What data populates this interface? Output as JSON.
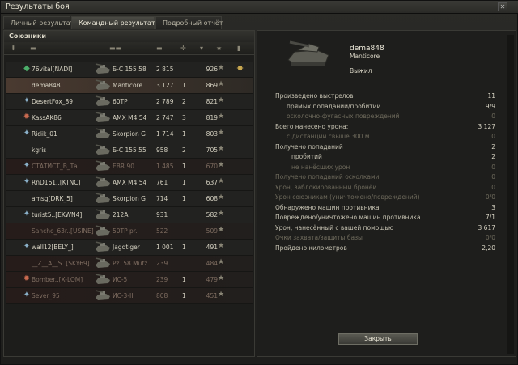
{
  "window": {
    "title": "Результаты боя"
  },
  "tabs": [
    {
      "label": "Личный результат",
      "active": false
    },
    {
      "label": "Командный результат",
      "active": true
    },
    {
      "label": "Подробный отчёт",
      "active": false
    }
  ],
  "team": {
    "header": "Союзники",
    "players": [
      {
        "name": "76vital[NADI]",
        "tank": "Б-С 155 58",
        "damage": "2 815",
        "kills": "",
        "xp": "926",
        "clan_icon": "clan-badge-green-icon",
        "dead": false,
        "highlight": false,
        "medal": true
      },
      {
        "name": "dema848",
        "tank": "Manticore",
        "damage": "3 127",
        "kills": "1",
        "xp": "869",
        "clan_icon": "",
        "dead": false,
        "highlight": true,
        "medal": false
      },
      {
        "name": "DesertFox_89",
        "tank": "60TP",
        "damage": "2 789",
        "kills": "2",
        "xp": "821",
        "clan_icon": "clan-badge-star-icon",
        "dead": false,
        "highlight": false,
        "medal": false
      },
      {
        "name": "KassAK86",
        "tank": "AMX M4 54",
        "damage": "2 747",
        "kills": "3",
        "xp": "819",
        "clan_icon": "clan-badge-red-icon",
        "dead": false,
        "highlight": false,
        "medal": false
      },
      {
        "name": "Ridik_01",
        "tank": "Skorpion G",
        "damage": "1 714",
        "kills": "1",
        "xp": "803",
        "clan_icon": "clan-badge-star-icon",
        "dead": false,
        "highlight": false,
        "medal": false
      },
      {
        "name": "kgris",
        "tank": "Б-С 155 55",
        "damage": "958",
        "kills": "2",
        "xp": "705",
        "clan_icon": "",
        "dead": false,
        "highlight": false,
        "medal": false
      },
      {
        "name": "СТАТИСТ_В_Та...",
        "tank": "EBR 90",
        "damage": "1 485",
        "kills": "1",
        "xp": "670",
        "clan_icon": "clan-badge-star-icon",
        "dead": true,
        "highlight": false,
        "medal": false
      },
      {
        "name": "RnD161..[KTNC]",
        "tank": "AMX M4 54",
        "damage": "761",
        "kills": "1",
        "xp": "637",
        "clan_icon": "clan-badge-star-icon",
        "dead": false,
        "highlight": false,
        "medal": false
      },
      {
        "name": "amsg[DRK_5]",
        "tank": "Skorpion G",
        "damage": "714",
        "kills": "1",
        "xp": "608",
        "clan_icon": "",
        "dead": false,
        "highlight": false,
        "medal": false
      },
      {
        "name": "turist5..[EKWN4]",
        "tank": "212A",
        "damage": "931",
        "kills": "",
        "xp": "582",
        "clan_icon": "clan-badge-star-icon",
        "dead": false,
        "highlight": false,
        "medal": false
      },
      {
        "name": "Sancho_63r..[USINE]",
        "tank": "50TP pr.",
        "damage": "522",
        "kills": "",
        "xp": "509",
        "clan_icon": "",
        "dead": true,
        "highlight": false,
        "medal": false
      },
      {
        "name": "wall12[BELY_]",
        "tank": "Jagdtiger",
        "damage": "1 001",
        "kills": "1",
        "xp": "491",
        "clan_icon": "clan-badge-star-icon",
        "dead": false,
        "highlight": false,
        "medal": false
      },
      {
        "name": "__Z__A__S..[SKY69]",
        "tank": "Pz. 58 Mutz",
        "damage": "239",
        "kills": "",
        "xp": "484",
        "clan_icon": "",
        "dead": true,
        "highlight": false,
        "medal": false
      },
      {
        "name": "Bomber..[X-LOM]",
        "tank": "ИС-5",
        "damage": "239",
        "kills": "1",
        "xp": "479",
        "clan_icon": "clan-badge-red-icon",
        "dead": true,
        "highlight": false,
        "medal": false
      },
      {
        "name": "Sever_95",
        "tank": "ИС-3-II",
        "damage": "808",
        "kills": "1",
        "xp": "451",
        "clan_icon": "clan-badge-star-icon",
        "dead": true,
        "highlight": false,
        "medal": false
      }
    ]
  },
  "player_detail": {
    "name": "dema848",
    "tank": "Manticore",
    "status": "Выжил",
    "stats": [
      {
        "label": "Произведено выстрелов",
        "value": "11",
        "level": 0,
        "muted": false
      },
      {
        "label": "прямых попаданий/пробитий",
        "value": "9/9",
        "level": 1,
        "muted": false
      },
      {
        "label": "осколочно-фугасных повреждений",
        "value": "0",
        "level": 1,
        "muted": true
      },
      {
        "label": "Всего нанесено урона:",
        "value": "3 127",
        "level": 0,
        "muted": false
      },
      {
        "label": "с дистанции свыше 300 м",
        "value": "0",
        "level": 1,
        "muted": true
      },
      {
        "label": "Получено попаданий",
        "value": "2",
        "level": 0,
        "muted": false
      },
      {
        "label": "пробитий",
        "value": "2",
        "level": 2,
        "muted": false
      },
      {
        "label": "не нанёсших урон",
        "value": "0",
        "level": 2,
        "muted": true
      },
      {
        "label": "Получено попаданий осколками",
        "value": "0",
        "level": 0,
        "muted": true
      },
      {
        "label": "Урон, заблокированный бронёй",
        "value": "0",
        "level": 0,
        "muted": true
      },
      {
        "label": "Урон союзникам (уничтожено/повреждений)",
        "value": "0/0",
        "level": 0,
        "muted": true
      },
      {
        "label": "Обнаружено машин противника",
        "value": "3",
        "level": 0,
        "muted": false
      },
      {
        "label": "Повреждено/уничтожено машин противника",
        "value": "7/1",
        "level": 0,
        "muted": false
      },
      {
        "label": "Урон, нанесённый с вашей помощью",
        "value": "3 617",
        "level": 0,
        "muted": false
      },
      {
        "label": "Очки захвата/защиты базы",
        "value": "0/0",
        "level": 0,
        "muted": true
      },
      {
        "label": "Пройдено километров",
        "value": "2,20",
        "level": 0,
        "muted": false
      }
    ]
  },
  "close_button": {
    "label": "Закрыть"
  },
  "colors": {
    "accent_highlight": "#4a3a30",
    "dead_text": "#7e6c60",
    "medal": "#c9a850"
  }
}
